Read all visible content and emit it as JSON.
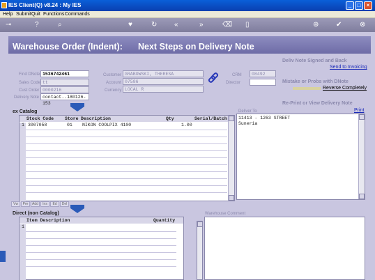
{
  "window": {
    "title": "IES Client(Q) v8.24 : My IES"
  },
  "menu": [
    "Help",
    "Submit",
    "Quit",
    "Functions",
    "Commands"
  ],
  "header": {
    "left": "Warehouse Order (Indent):",
    "right": "Next Steps on Delivery Note"
  },
  "form": {
    "find_dnote_label": "Find DNote",
    "find_dnote": "1536742461",
    "sales_code_label": "Sales Code",
    "sales_code": "tt",
    "cust_order_label": "Cust Order",
    "cust_order": "0000216",
    "delivery_note_label": "Delivery Note",
    "delivery_note": "contact..180126-153",
    "customer_label": "Customer",
    "customer": "GRABOWSKI, THERESA",
    "account_label": "Account",
    "account": "07586",
    "currency_label": "Currency",
    "currency": "LOCAL R",
    "crm_label": "CRM",
    "crm": "08492",
    "director_label": "Director",
    "director": ""
  },
  "right": {
    "signed_heading": "Deliv Note Signed and Back",
    "send_link": "Send to Invoicing",
    "mistake_heading": "Mistake or Probs with DNote",
    "reverse_link": "Reverse Completely",
    "reprint_heading": "Re-Print or View Delivery Note",
    "print_link": "Print",
    "deliver_to_label": "Deliver To",
    "deliver_to": [
      "11413 - 1263 STREET",
      "Suneria"
    ]
  },
  "ex_catalog": {
    "title": "ex Catalog",
    "columns": [
      "Stock Code",
      "Store",
      "Description",
      "Qty",
      "Serial/Batch"
    ],
    "rows": [
      {
        "no": "1",
        "code": "3007058",
        "store": "01",
        "desc": "NIKON COOLPIX 4100",
        "qty": "1.00",
        "serial": ""
      }
    ]
  },
  "tabs": [
    "Vw",
    "Pre",
    "Add",
    "Ins",
    "Ed",
    "Del"
  ],
  "direct": {
    "title": "Direct (non Catalog)",
    "columns": [
      "Item Description",
      "Quantity"
    ],
    "row_no": "1"
  },
  "warehouse_comment_label": "Warehouse Comment",
  "colors": {
    "header_bg": "#6e6ca7",
    "panel_bg": "#c9c6e0",
    "titlebar": "#0a5fd8"
  }
}
